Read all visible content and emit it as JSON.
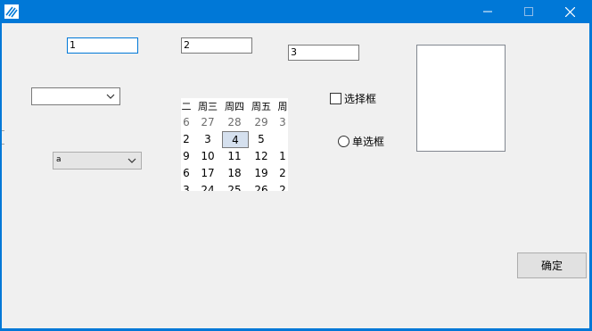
{
  "window": {
    "title": "",
    "controls": {
      "minimize": "—",
      "maximize": "☐",
      "close": "✕"
    },
    "icon": "app-logo-icon"
  },
  "textboxes": [
    {
      "value": "1"
    },
    {
      "value": "2"
    },
    {
      "value": "3"
    }
  ],
  "combo1": {
    "value": ""
  },
  "combo2": {
    "value": "a"
  },
  "calendar": {
    "headers": [
      "二",
      "周三",
      "周四",
      "周五",
      "周"
    ],
    "rows": [
      [
        "6",
        "27",
        "28",
        "29",
        "3"
      ],
      [
        "2",
        "3",
        "4",
        "5",
        ""
      ],
      [
        "9",
        "10",
        "11",
        "12",
        "1"
      ],
      [
        "6",
        "17",
        "18",
        "19",
        "2"
      ],
      [
        "3",
        "24",
        "25",
        "26",
        "2"
      ]
    ],
    "selected_day": "4"
  },
  "checkbox": {
    "label": "选择框",
    "checked": false
  },
  "radio": {
    "label": "单选框",
    "checked": false
  },
  "listbox": {
    "items": []
  },
  "button": {
    "label": "确定"
  }
}
